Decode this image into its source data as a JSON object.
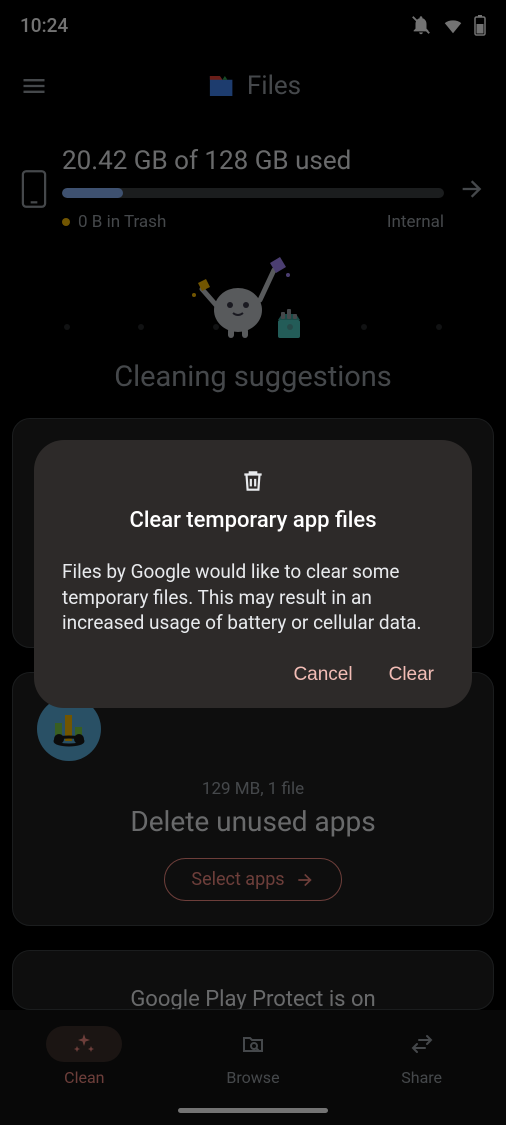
{
  "status": {
    "time": "10:24"
  },
  "app": {
    "title": "Files"
  },
  "storage": {
    "summary": "20.42 GB of 128 GB used",
    "trash": "0 B in Trash",
    "label": "Internal",
    "percent": 16
  },
  "suggestions_heading": "Cleaning suggestions",
  "cards": {
    "unused_apps": {
      "meta": "129 MB, 1 file",
      "title": "Delete unused apps",
      "action": "Select apps"
    },
    "play_protect": {
      "title": "Google Play Protect is on"
    }
  },
  "nav": {
    "clean": "Clean",
    "browse": "Browse",
    "share": "Share"
  },
  "dialog": {
    "title": "Clear temporary app files",
    "body": "Files by Google would like to clear some temporary files. This may result in an increased usage of battery or cellular data.",
    "cancel": "Cancel",
    "confirm": "Clear"
  }
}
